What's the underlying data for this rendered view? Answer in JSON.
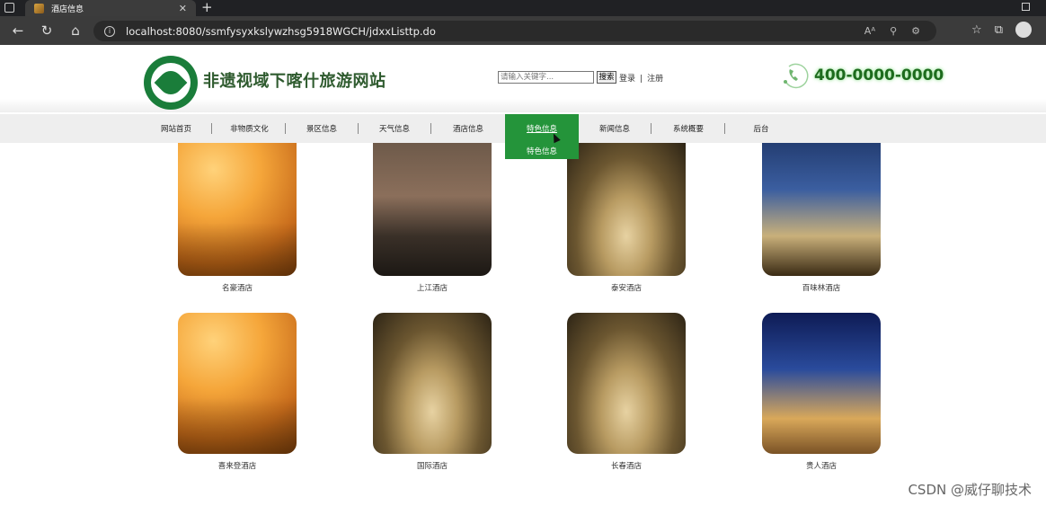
{
  "browser": {
    "tab_title": "酒店信息",
    "url": "localhost:8080/ssmfysyxkslywzhsg5918WGCH/jdxxListtp.do"
  },
  "header": {
    "site_title": "非遗视域下喀什旅游网站",
    "search_placeholder": "请输入关键字...",
    "search_button": "搜索",
    "login": "登录",
    "separator": "|",
    "register": "注册",
    "phone": "400-0000-0000"
  },
  "nav": {
    "items": [
      {
        "label": "网站首页"
      },
      {
        "label": "非物质文化"
      },
      {
        "label": "景区信息"
      },
      {
        "label": "天气信息"
      },
      {
        "label": "酒店信息"
      },
      {
        "label": "特色信息"
      },
      {
        "label": "新闻信息"
      },
      {
        "label": "系统概要"
      },
      {
        "label": "后台"
      }
    ],
    "active_index": 5,
    "dropdown_item": "特色信息",
    "accent_color": "#24943a"
  },
  "hotels": [
    {
      "name": "名豪酒店",
      "image": "hotel-room"
    },
    {
      "name": "上江酒店",
      "image": "hotel-facade"
    },
    {
      "name": "泰安酒店",
      "image": "hotel-lobby"
    },
    {
      "name": "百味林酒店",
      "image": "hotel-tower"
    },
    {
      "name": "喜来登酒店",
      "image": "hotel-room"
    },
    {
      "name": "国际酒店",
      "image": "hotel-lobby"
    },
    {
      "name": "长春酒店",
      "image": "hotel-lobby"
    },
    {
      "name": "贵人酒店",
      "image": "hotel-night"
    }
  ],
  "watermark": "CSDN @威仔聊技术"
}
